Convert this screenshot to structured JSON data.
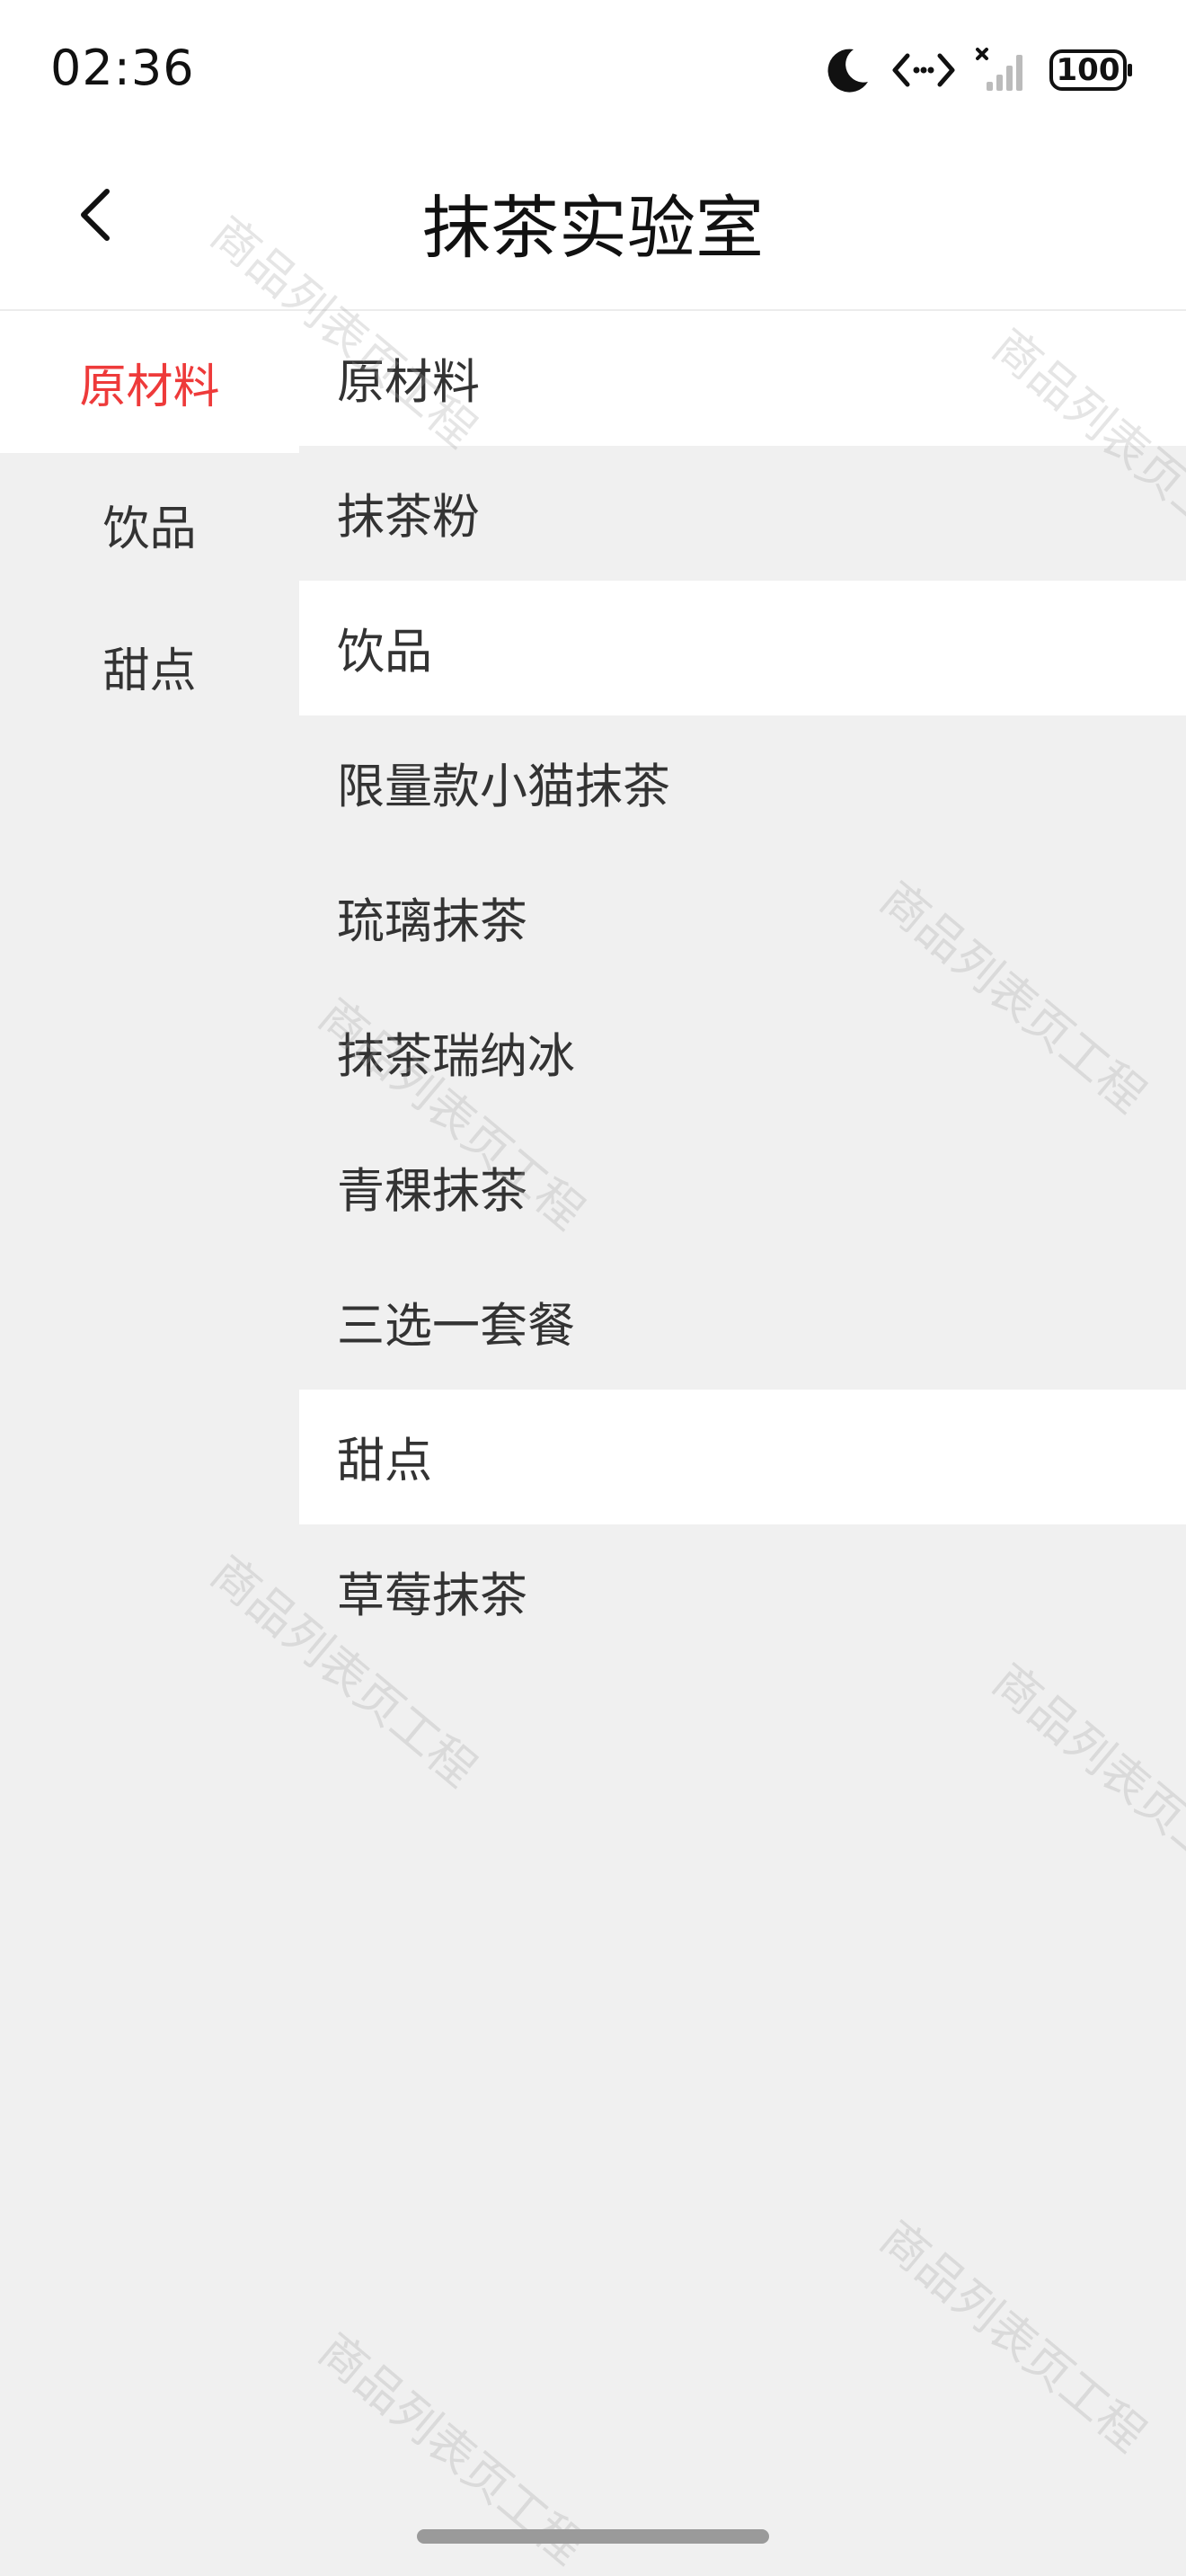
{
  "status_bar": {
    "time": "02:36",
    "battery": "100",
    "icons": [
      "moon-icon",
      "data-transfer-icon",
      "no-signal-icon",
      "battery-icon"
    ]
  },
  "header": {
    "back_icon": "chevron-left-icon",
    "title": "抹茶实验室"
  },
  "sidebar": {
    "items": [
      {
        "label": "原材料",
        "active": true
      },
      {
        "label": "饮品",
        "active": false
      },
      {
        "label": "甜点",
        "active": false
      }
    ]
  },
  "product_list": {
    "sections": [
      {
        "title": "原材料",
        "items": [
          "抹茶粉"
        ]
      },
      {
        "title": "饮品",
        "items": [
          "限量款小猫抹茶",
          "琉璃抹茶",
          "抹茶瑞纳冰",
          "青稞抹茶",
          "三选一套餐"
        ]
      },
      {
        "title": "甜点",
        "items": [
          "草莓抹茶"
        ]
      }
    ]
  },
  "watermark": {
    "text": "商品列表页工程"
  },
  "colors": {
    "active_accent": "#ee3a3a",
    "background": "#f0f0f0",
    "surface": "#ffffff",
    "text": "#333333"
  }
}
